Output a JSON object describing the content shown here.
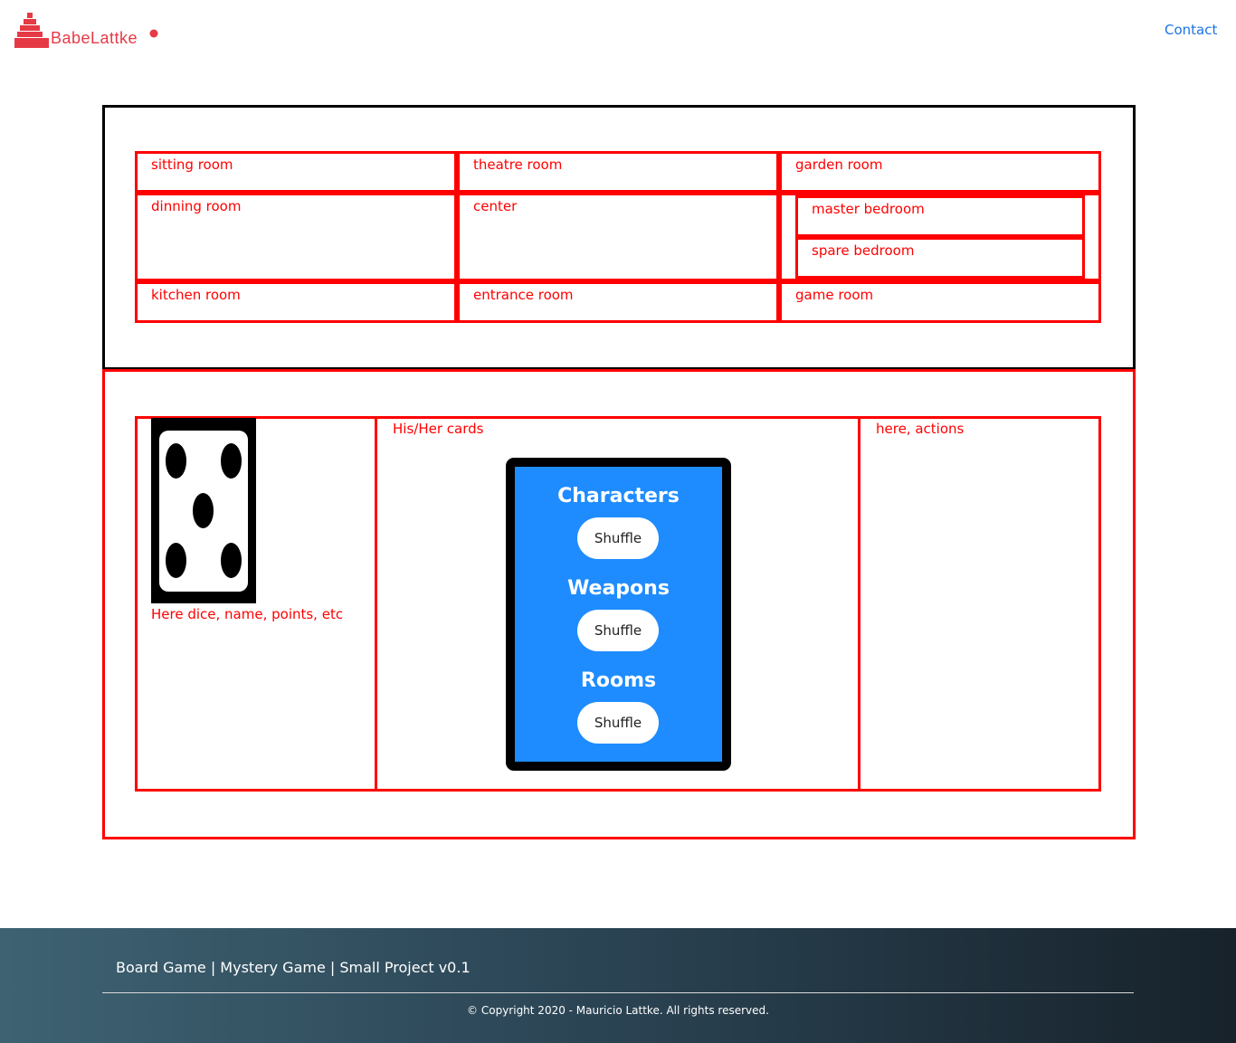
{
  "header": {
    "logo_text": "BabeLattke",
    "logo_color": "#e63946",
    "nav_contact": "Contact"
  },
  "board": {
    "rooms": [
      "sitting room",
      "theatre room",
      "garden room",
      "dinning room",
      "center",
      "master bedroom",
      "spare bedroom",
      "kitchen room",
      "entrance room",
      "game room"
    ]
  },
  "player_area": {
    "dice_panel_label": "Here dice, name, points, etc",
    "dice_value": 5,
    "cards_panel_label": "His/Her cards",
    "actions_panel_label": "here, actions"
  },
  "deck": {
    "sections": [
      {
        "heading": "Characters",
        "button": "Shuffle"
      },
      {
        "heading": "Weapons",
        "button": "Shuffle"
      },
      {
        "heading": "Rooms",
        "button": "Shuffle"
      }
    ],
    "background_color": "#1e8cff"
  },
  "footer": {
    "title": "Board Game | Mystery Game | Small Project v0.1",
    "copyright": "© Copyright 2020 - Mauricio Lattke. All rights reserved."
  },
  "colors": {
    "border_red": "#ff0000",
    "link_blue": "#1a73e8"
  }
}
